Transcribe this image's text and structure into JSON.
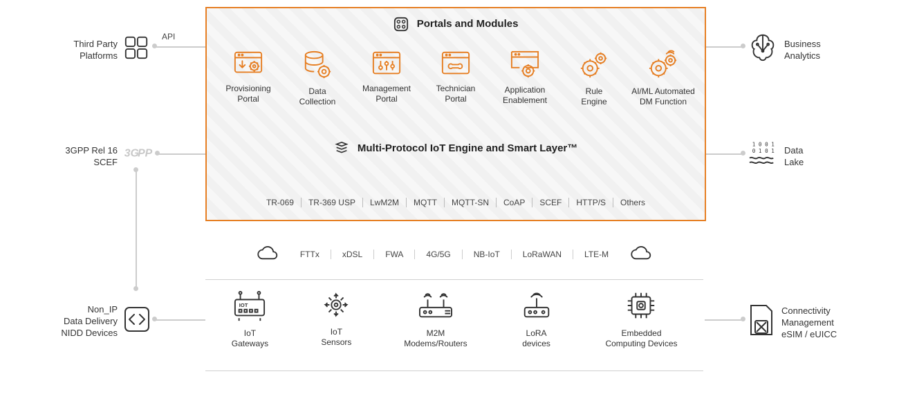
{
  "left": {
    "third_party": "Third Party\nPlatforms",
    "api": "API",
    "scef": "3GPP Rel 16\nSCEF",
    "nidd": "Non_IP\nData Delivery\nNIDD Devices"
  },
  "right": {
    "ba": "Business\nAnalytics",
    "dl": "Data\nLake",
    "conn": "Connectivity\nManagement\neSIM / eUICC"
  },
  "pm_title": "Portals and Modules",
  "modules": [
    {
      "label": "Provisioning\nPortal",
      "icon": "provisioning-icon"
    },
    {
      "label": "Data\nCollection",
      "icon": "data-collection-icon"
    },
    {
      "label": "Management\nPortal",
      "icon": "management-portal-icon"
    },
    {
      "label": "Technician\nPortal",
      "icon": "technician-portal-icon"
    },
    {
      "label": "Application\nEnablement",
      "icon": "app-enablement-icon"
    },
    {
      "label": "Rule\nEngine",
      "icon": "rule-engine-icon"
    },
    {
      "label": "AI/ML Automated\nDM Function",
      "icon": "aiml-icon"
    }
  ],
  "mp_title": "Multi-Protocol IoT Engine and Smart Layer™",
  "protocols": [
    "TR-069",
    "TR-369 USP",
    "LwM2M",
    "MQTT",
    "MQTT-SN",
    "CoAP",
    "SCEF",
    "HTTP/S",
    "Others"
  ],
  "networks": [
    "FTTx",
    "xDSL",
    "FWA",
    "4G/5G",
    "NB-IoT",
    "LoRaWAN",
    "LTE-M"
  ],
  "devices": [
    {
      "label": "IoT\nGateways",
      "icon": "iot-gateway-icon"
    },
    {
      "label": "IoT\nSensors",
      "icon": "iot-sensor-icon"
    },
    {
      "label": "M2M\nModems/Routers",
      "icon": "m2m-router-icon"
    },
    {
      "label": "LoRA\ndevices",
      "icon": "lora-device-icon"
    },
    {
      "label": "Embedded\nComputing Devices",
      "icon": "embedded-chip-icon"
    }
  ]
}
